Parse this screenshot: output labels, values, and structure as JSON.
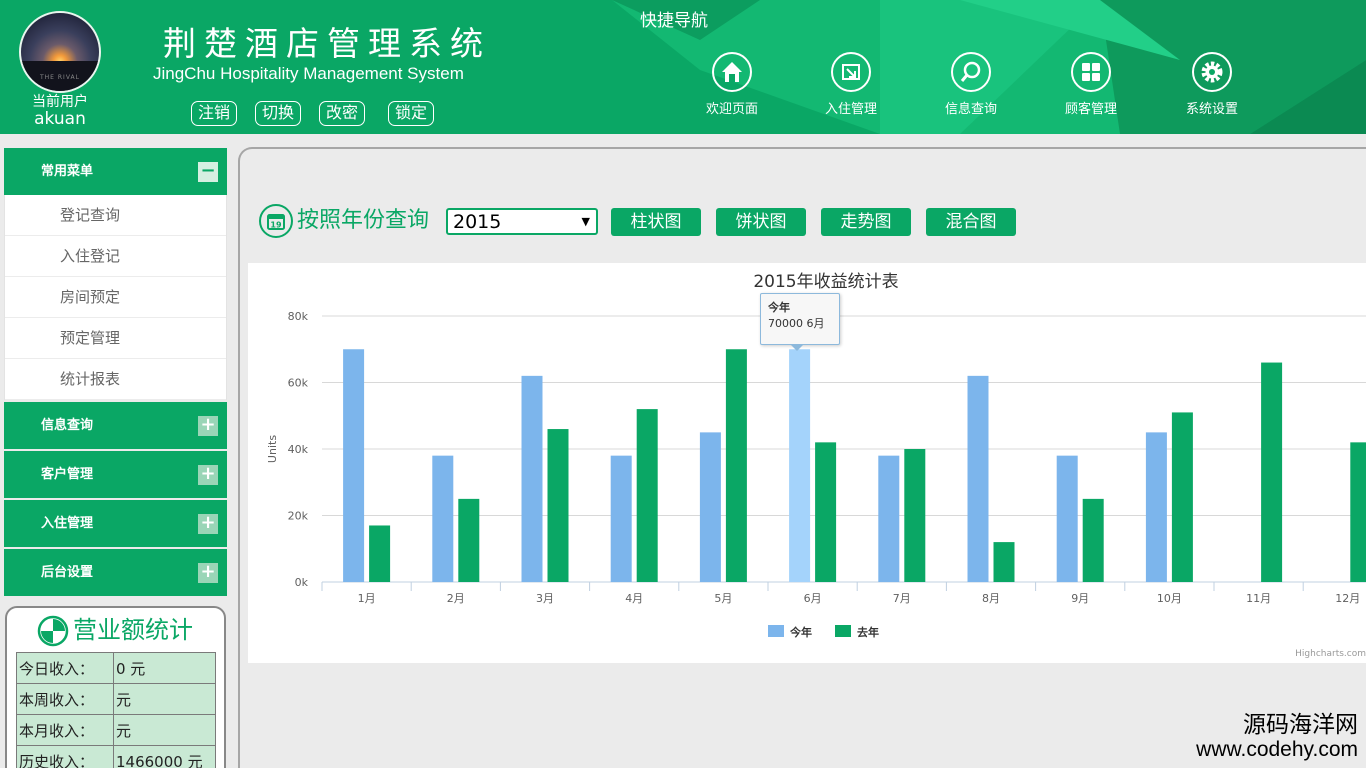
{
  "header": {
    "title": "荆楚酒店管理系统",
    "subtitle": "JingChu Hospitality Management System",
    "user_label": "当前用户",
    "user_name": "akuan",
    "avatar_text": "THE RIVAL",
    "buttons": [
      "注销",
      "切换",
      "改密",
      "锁定"
    ],
    "quick_nav_title": "快捷导航",
    "nav_items": [
      {
        "label": "欢迎页面",
        "icon": "home-icon"
      },
      {
        "label": "入住管理",
        "icon": "checkin-icon"
      },
      {
        "label": "信息查询",
        "icon": "search-icon"
      },
      {
        "label": "顾客管理",
        "icon": "grid-icon"
      },
      {
        "label": "系统设置",
        "icon": "gear-icon"
      }
    ],
    "colors": {
      "primary": "#0aa765",
      "accent": "#12c27a"
    }
  },
  "sidebar": {
    "common_menu": {
      "label": "常用菜单",
      "toggle": "−",
      "items": [
        "登记查询",
        "入住登记",
        "房间预定",
        "预定管理",
        "统计报表"
      ]
    },
    "menus": [
      {
        "label": "信息查询",
        "toggle": "+"
      },
      {
        "label": "客户管理",
        "toggle": "+"
      },
      {
        "label": "入住管理",
        "toggle": "+"
      },
      {
        "label": "后台设置",
        "toggle": "+"
      }
    ]
  },
  "revenue": {
    "title": "营业额统计",
    "rows": [
      {
        "label": "今日收入：",
        "value": "0 元"
      },
      {
        "label": "本周收入：",
        "value": "元"
      },
      {
        "label": "本月收入：",
        "value": "元"
      },
      {
        "label": "历史收入：",
        "value": "1466000 元"
      }
    ]
  },
  "query": {
    "label": "按照年份查询",
    "calendar_day": "19",
    "selected_year": "2015",
    "buttons": [
      "柱状图",
      "饼状图",
      "走势图",
      "混合图"
    ]
  },
  "tooltip": {
    "series": "今年",
    "text": "70000 6月"
  },
  "chart_credit": "Highcharts.com",
  "watermark": {
    "line1": "源码海洋网",
    "line2": "www.codehy.com"
  },
  "chart_data": {
    "type": "bar",
    "title": "2015年收益统计表",
    "xlabel": "",
    "ylabel": "Units",
    "categories": [
      "1月",
      "2月",
      "3月",
      "4月",
      "5月",
      "6月",
      "7月",
      "8月",
      "9月",
      "10月",
      "11月",
      "12月"
    ],
    "series": [
      {
        "name": "今年",
        "color": "#7cb5ec",
        "values": [
          70000,
          38000,
          62000,
          38000,
          45000,
          70000,
          38000,
          62000,
          38000,
          45000,
          0,
          0
        ]
      },
      {
        "name": "去年",
        "color": "#0aa765",
        "values": [
          17000,
          25000,
          46000,
          52000,
          70000,
          42000,
          40000,
          12000,
          25000,
          51000,
          66000,
          42000
        ]
      }
    ],
    "y_ticks": [
      "0k",
      "20k",
      "40k",
      "60k",
      "80k"
    ],
    "ylim": [
      0,
      80000
    ],
    "grid": true,
    "legend_position": "bottom-center",
    "highlighted": {
      "series": "今年",
      "category": "6月",
      "color": "#a4d3fb"
    }
  }
}
